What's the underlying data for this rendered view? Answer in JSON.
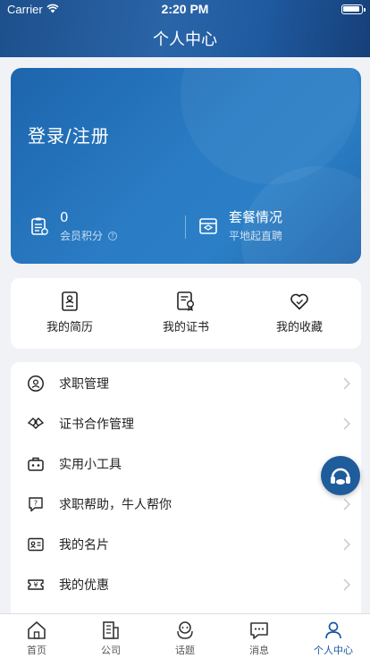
{
  "status": {
    "carrier": "Carrier",
    "time": "2:20 PM"
  },
  "header": {
    "title": "个人中心"
  },
  "card": {
    "login": "登录/注册",
    "points_value": "0",
    "points_label": "会员积分",
    "plan_title": "套餐情况",
    "plan_sub": "平地起直聘"
  },
  "quick": [
    {
      "label": "我的简历",
      "icon": "resume-icon"
    },
    {
      "label": "我的证书",
      "icon": "certificate-icon"
    },
    {
      "label": "我的收藏",
      "icon": "heart-icon"
    }
  ],
  "menu": [
    {
      "label": "求职管理",
      "icon": "job-search-icon"
    },
    {
      "label": "证书合作管理",
      "icon": "handshake-icon"
    },
    {
      "label": "实用小工具",
      "icon": "toolbox-icon"
    },
    {
      "label": "求职帮助，牛人帮你",
      "icon": "help-chat-icon"
    },
    {
      "label": "我的名片",
      "icon": "business-card-icon"
    },
    {
      "label": "我的优惠",
      "icon": "coupon-icon"
    }
  ],
  "tabs": [
    {
      "label": "首页",
      "icon": "home-icon"
    },
    {
      "label": "公司",
      "icon": "building-icon"
    },
    {
      "label": "话题",
      "icon": "topic-icon"
    },
    {
      "label": "消息",
      "icon": "message-icon"
    },
    {
      "label": "个人中心",
      "icon": "person-icon"
    }
  ],
  "colors": {
    "primary": "#1a57a0",
    "header": "#1d4f8c",
    "card": "#2a7cc4"
  }
}
